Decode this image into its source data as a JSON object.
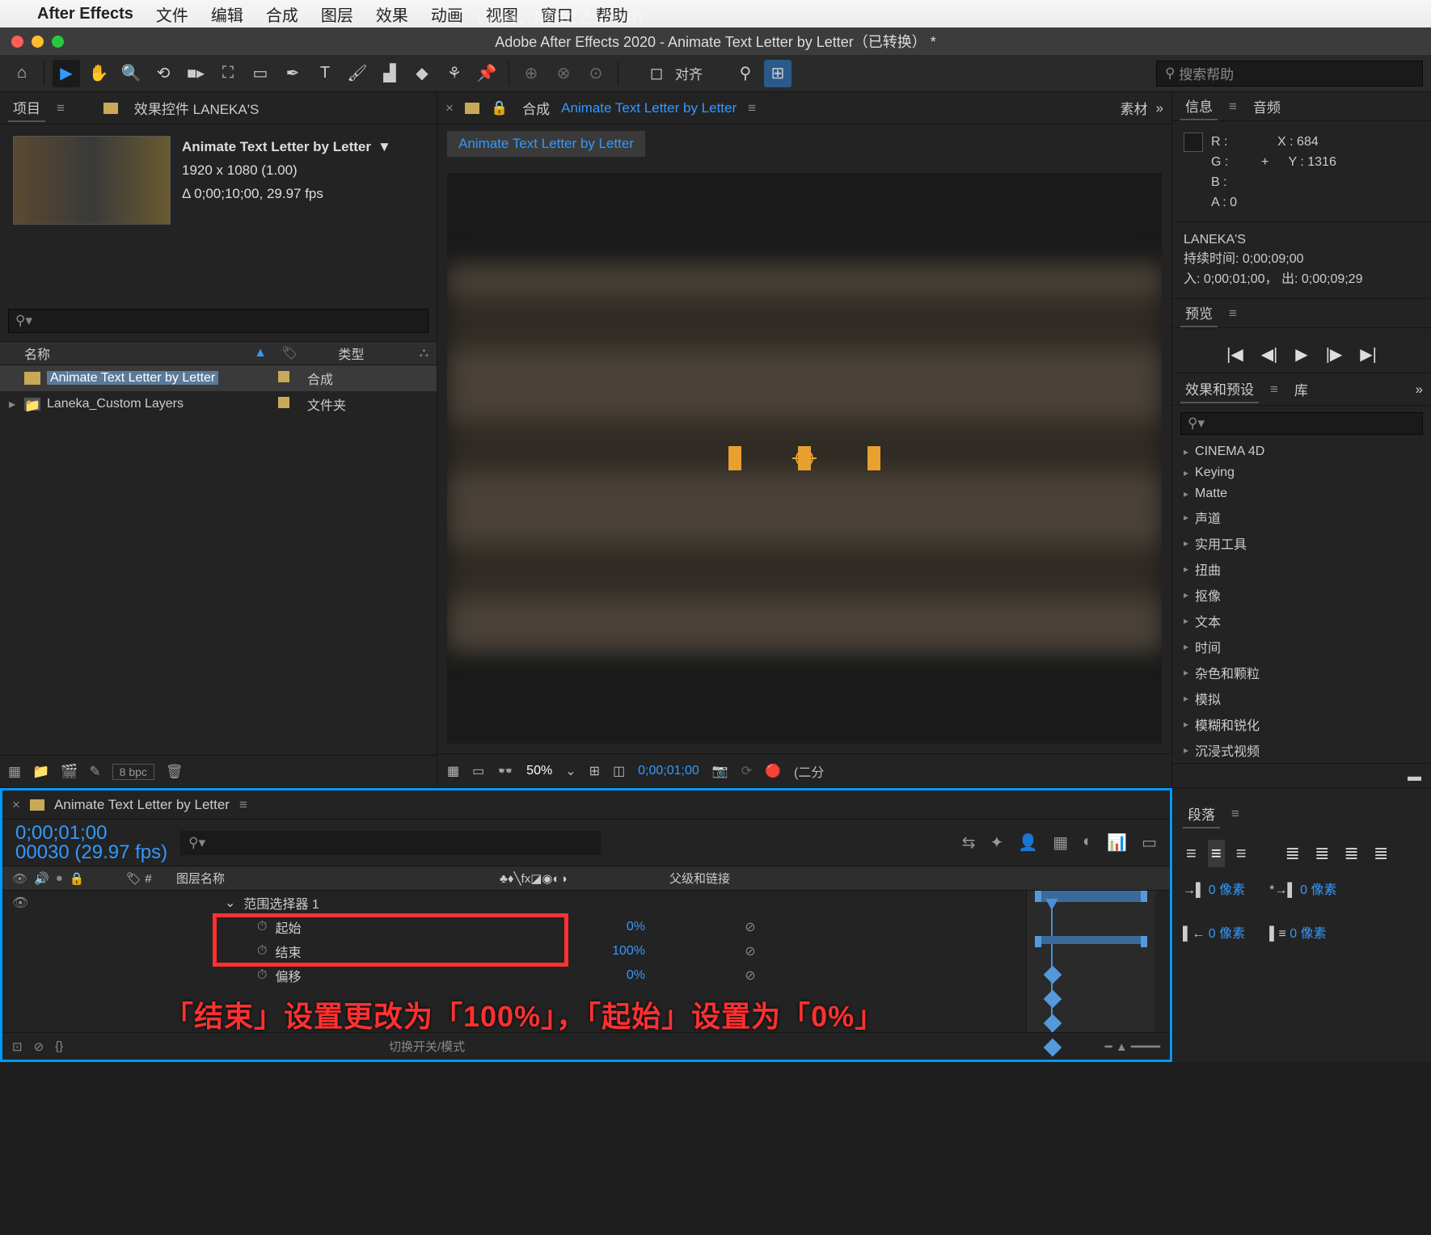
{
  "menubar": {
    "app": "After Effects",
    "items": [
      "文件",
      "编辑",
      "合成",
      "图层",
      "效果",
      "动画",
      "视图",
      "窗口",
      "帮助"
    ]
  },
  "watermark": "www.MacZ.com",
  "title": "Adobe After Effects 2020 - Animate Text Letter by Letter（已转换） *",
  "toolbar": {
    "align": "对齐",
    "search_placeholder": "搜索帮助"
  },
  "project": {
    "tab": "项目",
    "tab_effect": "效果控件 LANEKA'S",
    "comp_name": "Animate Text Letter by Letter",
    "dropdown": "▼",
    "dims": "1920 x 1080 (1.00)",
    "dur": "Δ 0;00;10;00, 29.97 fps",
    "col_name": "名称",
    "col_type": "类型",
    "bpc": "8 bpc",
    "rows": [
      {
        "name": "Animate Text Letter by Letter",
        "type": "合成",
        "kind": "comp",
        "selected": true
      },
      {
        "name": "Laneka_Custom Layers",
        "type": "文件夹",
        "kind": "folder",
        "selected": false
      }
    ]
  },
  "composition": {
    "tab_prefix": "合成",
    "name": "Animate Text Letter by Letter",
    "right": "素材",
    "tab_label": "Animate Text Letter by Letter",
    "footer": {
      "zoom": "50%",
      "time": "0;00;01;00",
      "quality": "(二分"
    }
  },
  "info": {
    "title": "信息",
    "audio": "音频",
    "r": "R :",
    "g": "G :",
    "b": "B :",
    "a": "A :  0",
    "x": "X : 684",
    "y": "Y : 1316",
    "layer": "LANEKA'S",
    "dur": "持续时间: 0;00;09;00",
    "inout": "入: 0;00;01;00，  出: 0;00;09;29"
  },
  "preview": {
    "title": "预览"
  },
  "effects": {
    "title": "效果和预设",
    "lib": "库",
    "items": [
      "CINEMA 4D",
      "Keying",
      "Matte",
      "声道",
      "实用工具",
      "扭曲",
      "抠像",
      "文本",
      "时间",
      "杂色和颗粒",
      "模拟",
      "模糊和锐化",
      "沉浸式视频"
    ]
  },
  "timeline": {
    "tab": "Animate Text Letter by Letter",
    "time": "0;00;01;00",
    "sub": "00030 (29.97 fps)",
    "col_num": "#",
    "col_layer": "图层名称",
    "col_parent": "父级和链接",
    "col_switches": "♣♦╲fx◪◉◐◑",
    "rows": [
      {
        "indent": "▾",
        "name": "范围选择器 1",
        "val": "",
        "link": ""
      },
      {
        "indent": "",
        "icon": "⏱",
        "name": "起始",
        "val": "0%",
        "link": "⊘",
        "boxed": true
      },
      {
        "indent": "",
        "icon": "⏱",
        "name": "结束",
        "val": "100%",
        "link": "⊘",
        "boxed": true
      },
      {
        "indent": "",
        "icon": "⏱",
        "name": "偏移",
        "val": "0%",
        "link": "⊘",
        "boxed": false
      }
    ],
    "footer": "切换开关/模式"
  },
  "paragraph": {
    "title": "段落",
    "indents": [
      {
        "label": "→▌",
        "val": "0 像素"
      },
      {
        "label": "*→▌",
        "val": "0 像素"
      },
      {
        "label": "▌←",
        "val": "0 像素"
      },
      {
        "label": "▌≡",
        "val": "0 像素"
      }
    ]
  },
  "annotation": "「结束」设置更改为「100%」，「起始」设置为「0%」"
}
